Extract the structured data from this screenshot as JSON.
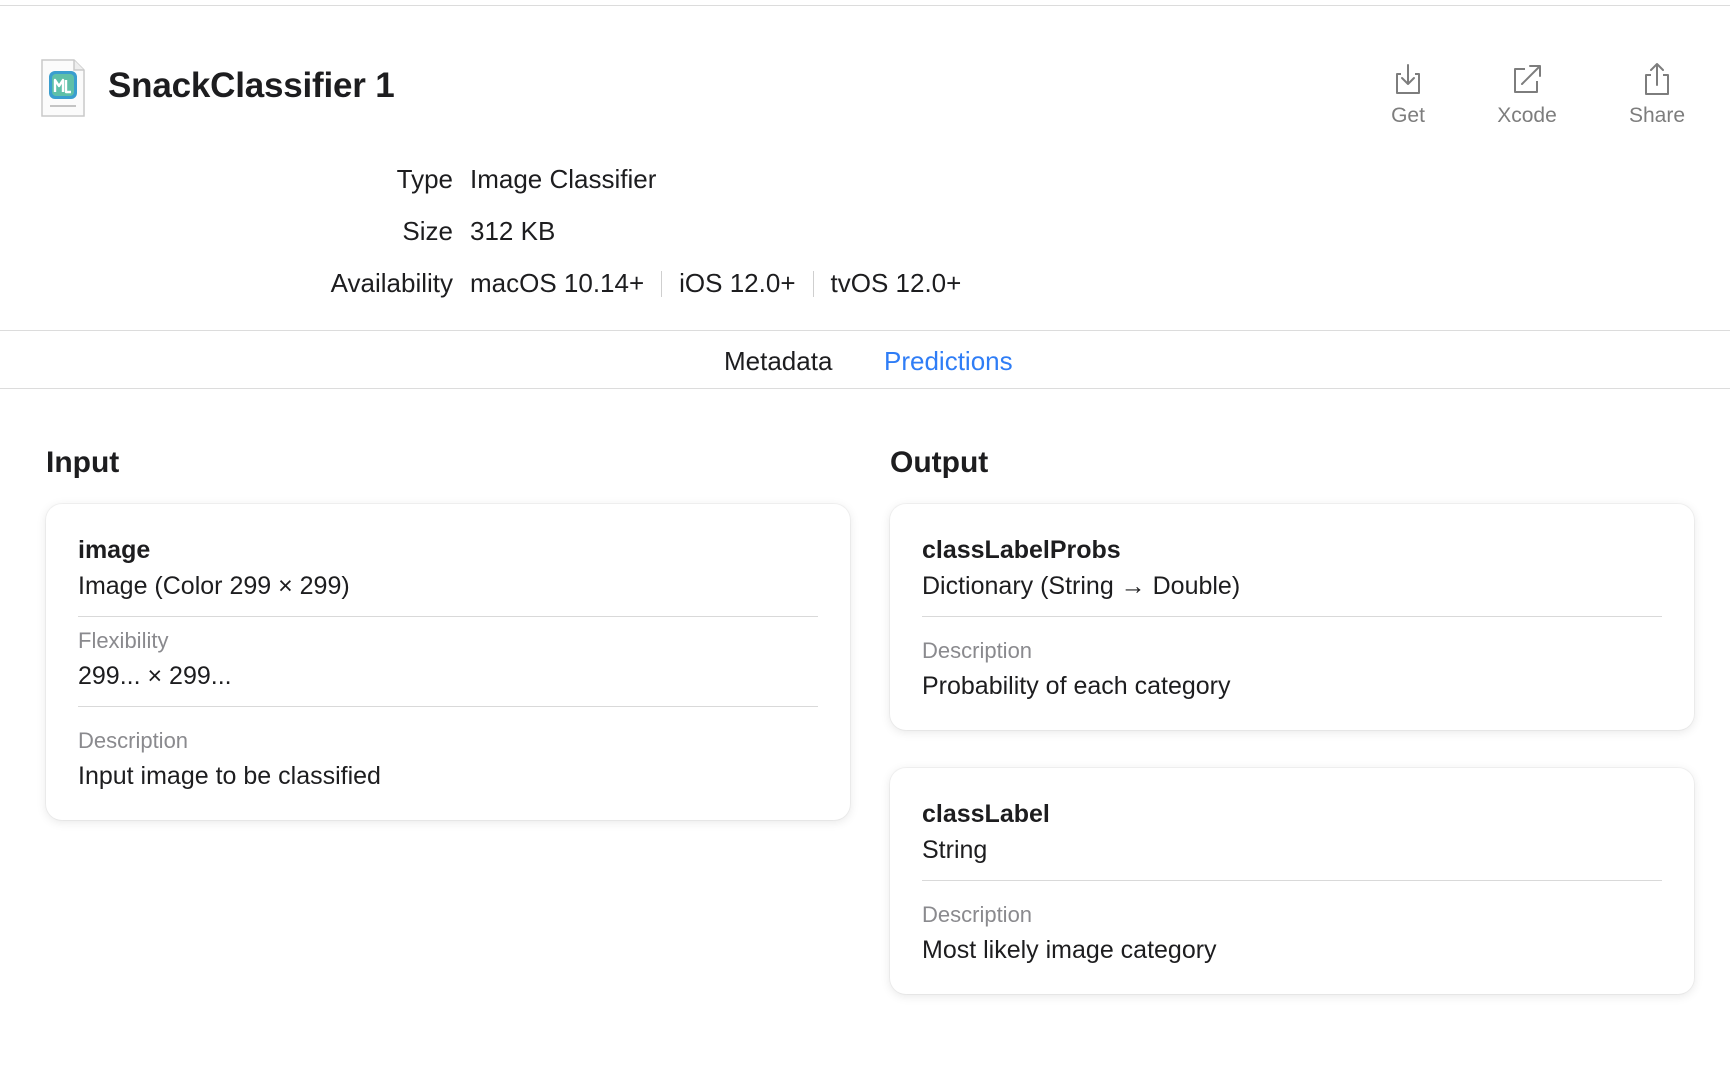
{
  "model": {
    "title": "SnackClassifier 1",
    "icon": "mlmodel-file-icon"
  },
  "actions": {
    "get": {
      "label": "Get",
      "icon": "download-icon"
    },
    "xcode": {
      "label": "Xcode",
      "icon": "open-external-icon"
    },
    "share": {
      "label": "Share",
      "icon": "share-icon"
    }
  },
  "info": {
    "type": {
      "key": "Type",
      "value": "Image Classifier"
    },
    "size": {
      "key": "Size",
      "value": "312 KB"
    },
    "availability": {
      "key": "Availability",
      "values": [
        "macOS 10.14+",
        "iOS 12.0+",
        "tvOS 12.0+"
      ]
    }
  },
  "tabs": [
    {
      "label": "Metadata",
      "active": false
    },
    {
      "label": "Predictions",
      "active": true
    }
  ],
  "input": {
    "heading": "Input",
    "fields": [
      {
        "name": "image",
        "type": "Image (Color 299 × 299)",
        "flexibility_label": "Flexibility",
        "flexibility": "299... × 299...",
        "description_label": "Description",
        "description": "Input image to be classified"
      }
    ]
  },
  "output": {
    "heading": "Output",
    "fields": [
      {
        "name": "classLabelProbs",
        "type": "Dictionary (String → Double)",
        "description_label": "Description",
        "description": "Probability of each category"
      },
      {
        "name": "classLabel",
        "type": "String",
        "description_label": "Description",
        "description": "Most likely image category"
      }
    ]
  },
  "colors": {
    "accent": "#2f7df6",
    "text": "#1d1d1f",
    "secondary": "#8a8a8e"
  }
}
